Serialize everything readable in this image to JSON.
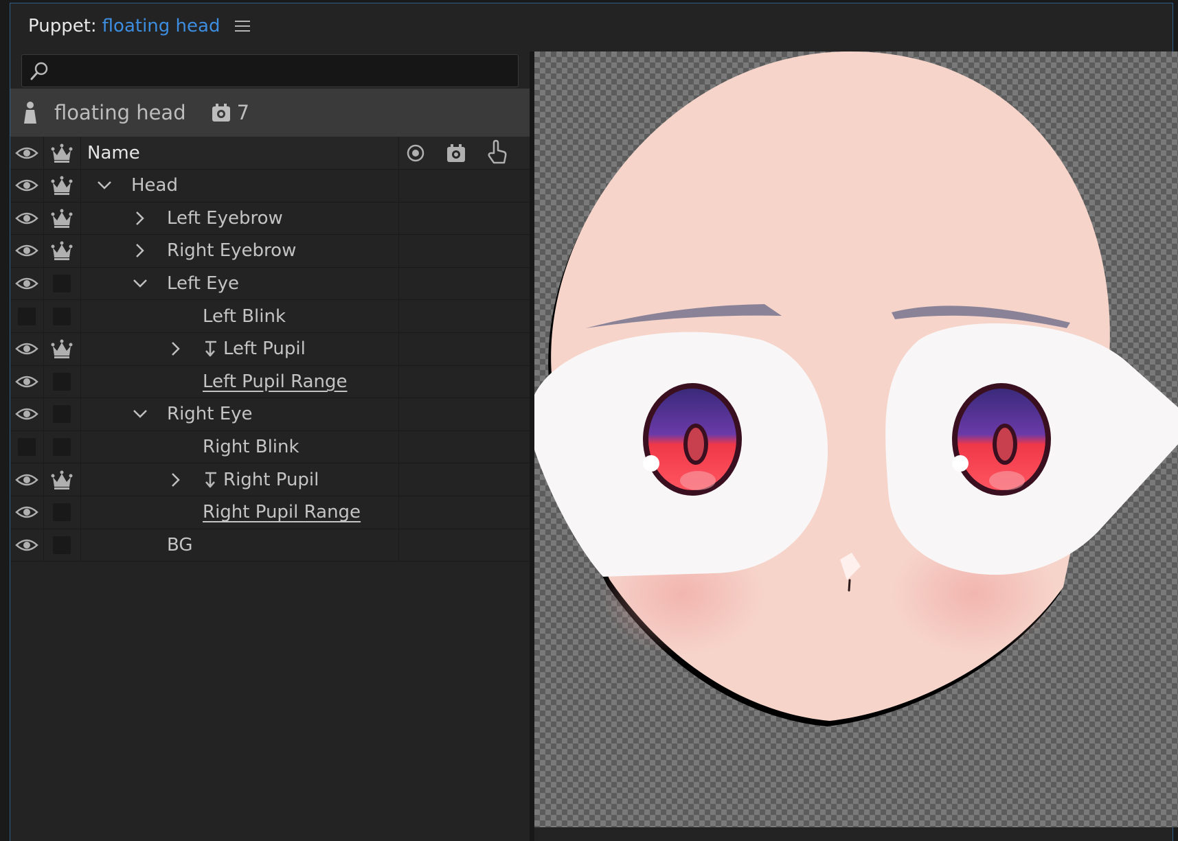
{
  "panel": {
    "title_prefix": "Puppet:",
    "title_name": "floating head"
  },
  "search": {
    "value": "",
    "placeholder": ""
  },
  "puppet_bar": {
    "name": "floating head",
    "behavior_count": "7"
  },
  "table": {
    "header_name": "Name",
    "rows": [
      {
        "label": "Head",
        "depth": 0,
        "chevron": "down",
        "eye": true,
        "crown": true,
        "handle": false,
        "underline": false
      },
      {
        "label": "Left Eyebrow",
        "depth": 1,
        "chevron": "right",
        "eye": true,
        "crown": true,
        "handle": false,
        "underline": false
      },
      {
        "label": "Right Eyebrow",
        "depth": 1,
        "chevron": "right",
        "eye": true,
        "crown": true,
        "handle": false,
        "underline": false
      },
      {
        "label": "Left Eye",
        "depth": 1,
        "chevron": "down",
        "eye": true,
        "crown": false,
        "handle": false,
        "underline": false
      },
      {
        "label": "Left Blink",
        "depth": 2,
        "chevron": "none",
        "eye": false,
        "crown": false,
        "handle": false,
        "underline": false
      },
      {
        "label": "Left Pupil",
        "depth": 2,
        "chevron": "right",
        "eye": true,
        "crown": true,
        "handle": true,
        "underline": false
      },
      {
        "label": "Left Pupil Range",
        "depth": 2,
        "chevron": "none",
        "eye": true,
        "crown": false,
        "handle": false,
        "underline": true
      },
      {
        "label": "Right Eye",
        "depth": 1,
        "chevron": "down",
        "eye": true,
        "crown": false,
        "handle": false,
        "underline": false
      },
      {
        "label": "Right Blink",
        "depth": 2,
        "chevron": "none",
        "eye": false,
        "crown": false,
        "handle": false,
        "underline": false
      },
      {
        "label": "Right Pupil",
        "depth": 2,
        "chevron": "right",
        "eye": true,
        "crown": true,
        "handle": true,
        "underline": false
      },
      {
        "label": "Right Pupil Range",
        "depth": 2,
        "chevron": "none",
        "eye": true,
        "crown": false,
        "handle": false,
        "underline": true
      },
      {
        "label": "BG",
        "depth": 1,
        "chevron": "none",
        "eye": true,
        "crown": false,
        "handle": false,
        "underline": false
      }
    ]
  },
  "icons": {
    "eye": "eye-icon",
    "crown": "crown-icon",
    "search": "search-icon",
    "menu": "hamburger-menu-icon",
    "puppet": "puppet-figure-icon",
    "behavior": "behavior-gear-icon",
    "handle": "handle-arrow-icon",
    "target": "target-circle-icon",
    "hand": "hand-pointer-icon"
  },
  "colors": {
    "accent": "#3d8de0",
    "panel_bg": "#232323",
    "puppet_bar_bg": "#3a3a3a",
    "skin": "#f6d2c7",
    "iris_red": "#ee3a48",
    "iris_purple": "#5c3a9a"
  }
}
